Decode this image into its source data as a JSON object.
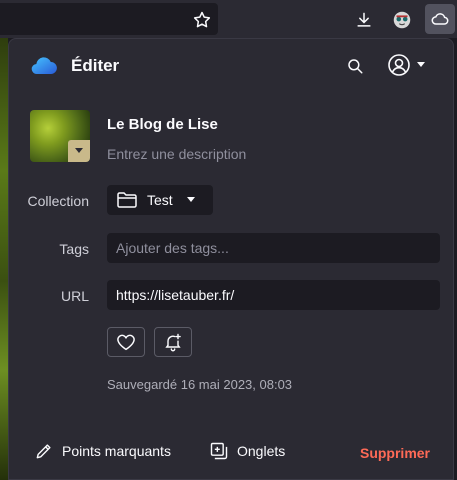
{
  "popup": {
    "title": "Éditer",
    "site_name": "Le Blog de Lise",
    "description_placeholder": "Entrez une description",
    "collection": {
      "label": "Collection",
      "value": "Test"
    },
    "tags": {
      "label": "Tags",
      "placeholder": "Ajouter des tags..."
    },
    "url": {
      "label": "URL",
      "value": "https://lisetauber.fr/"
    },
    "saved_text": "Sauvegardé 16 mai 2023, 08:03",
    "footer": {
      "highlights_label": "Points marquants",
      "tabs_label": "Onglets",
      "delete_label": "Supprimer"
    }
  },
  "colors": {
    "accent_delete": "#ff6a57",
    "panel_bg": "#2b2a33",
    "field_bg": "#1c1b22"
  }
}
